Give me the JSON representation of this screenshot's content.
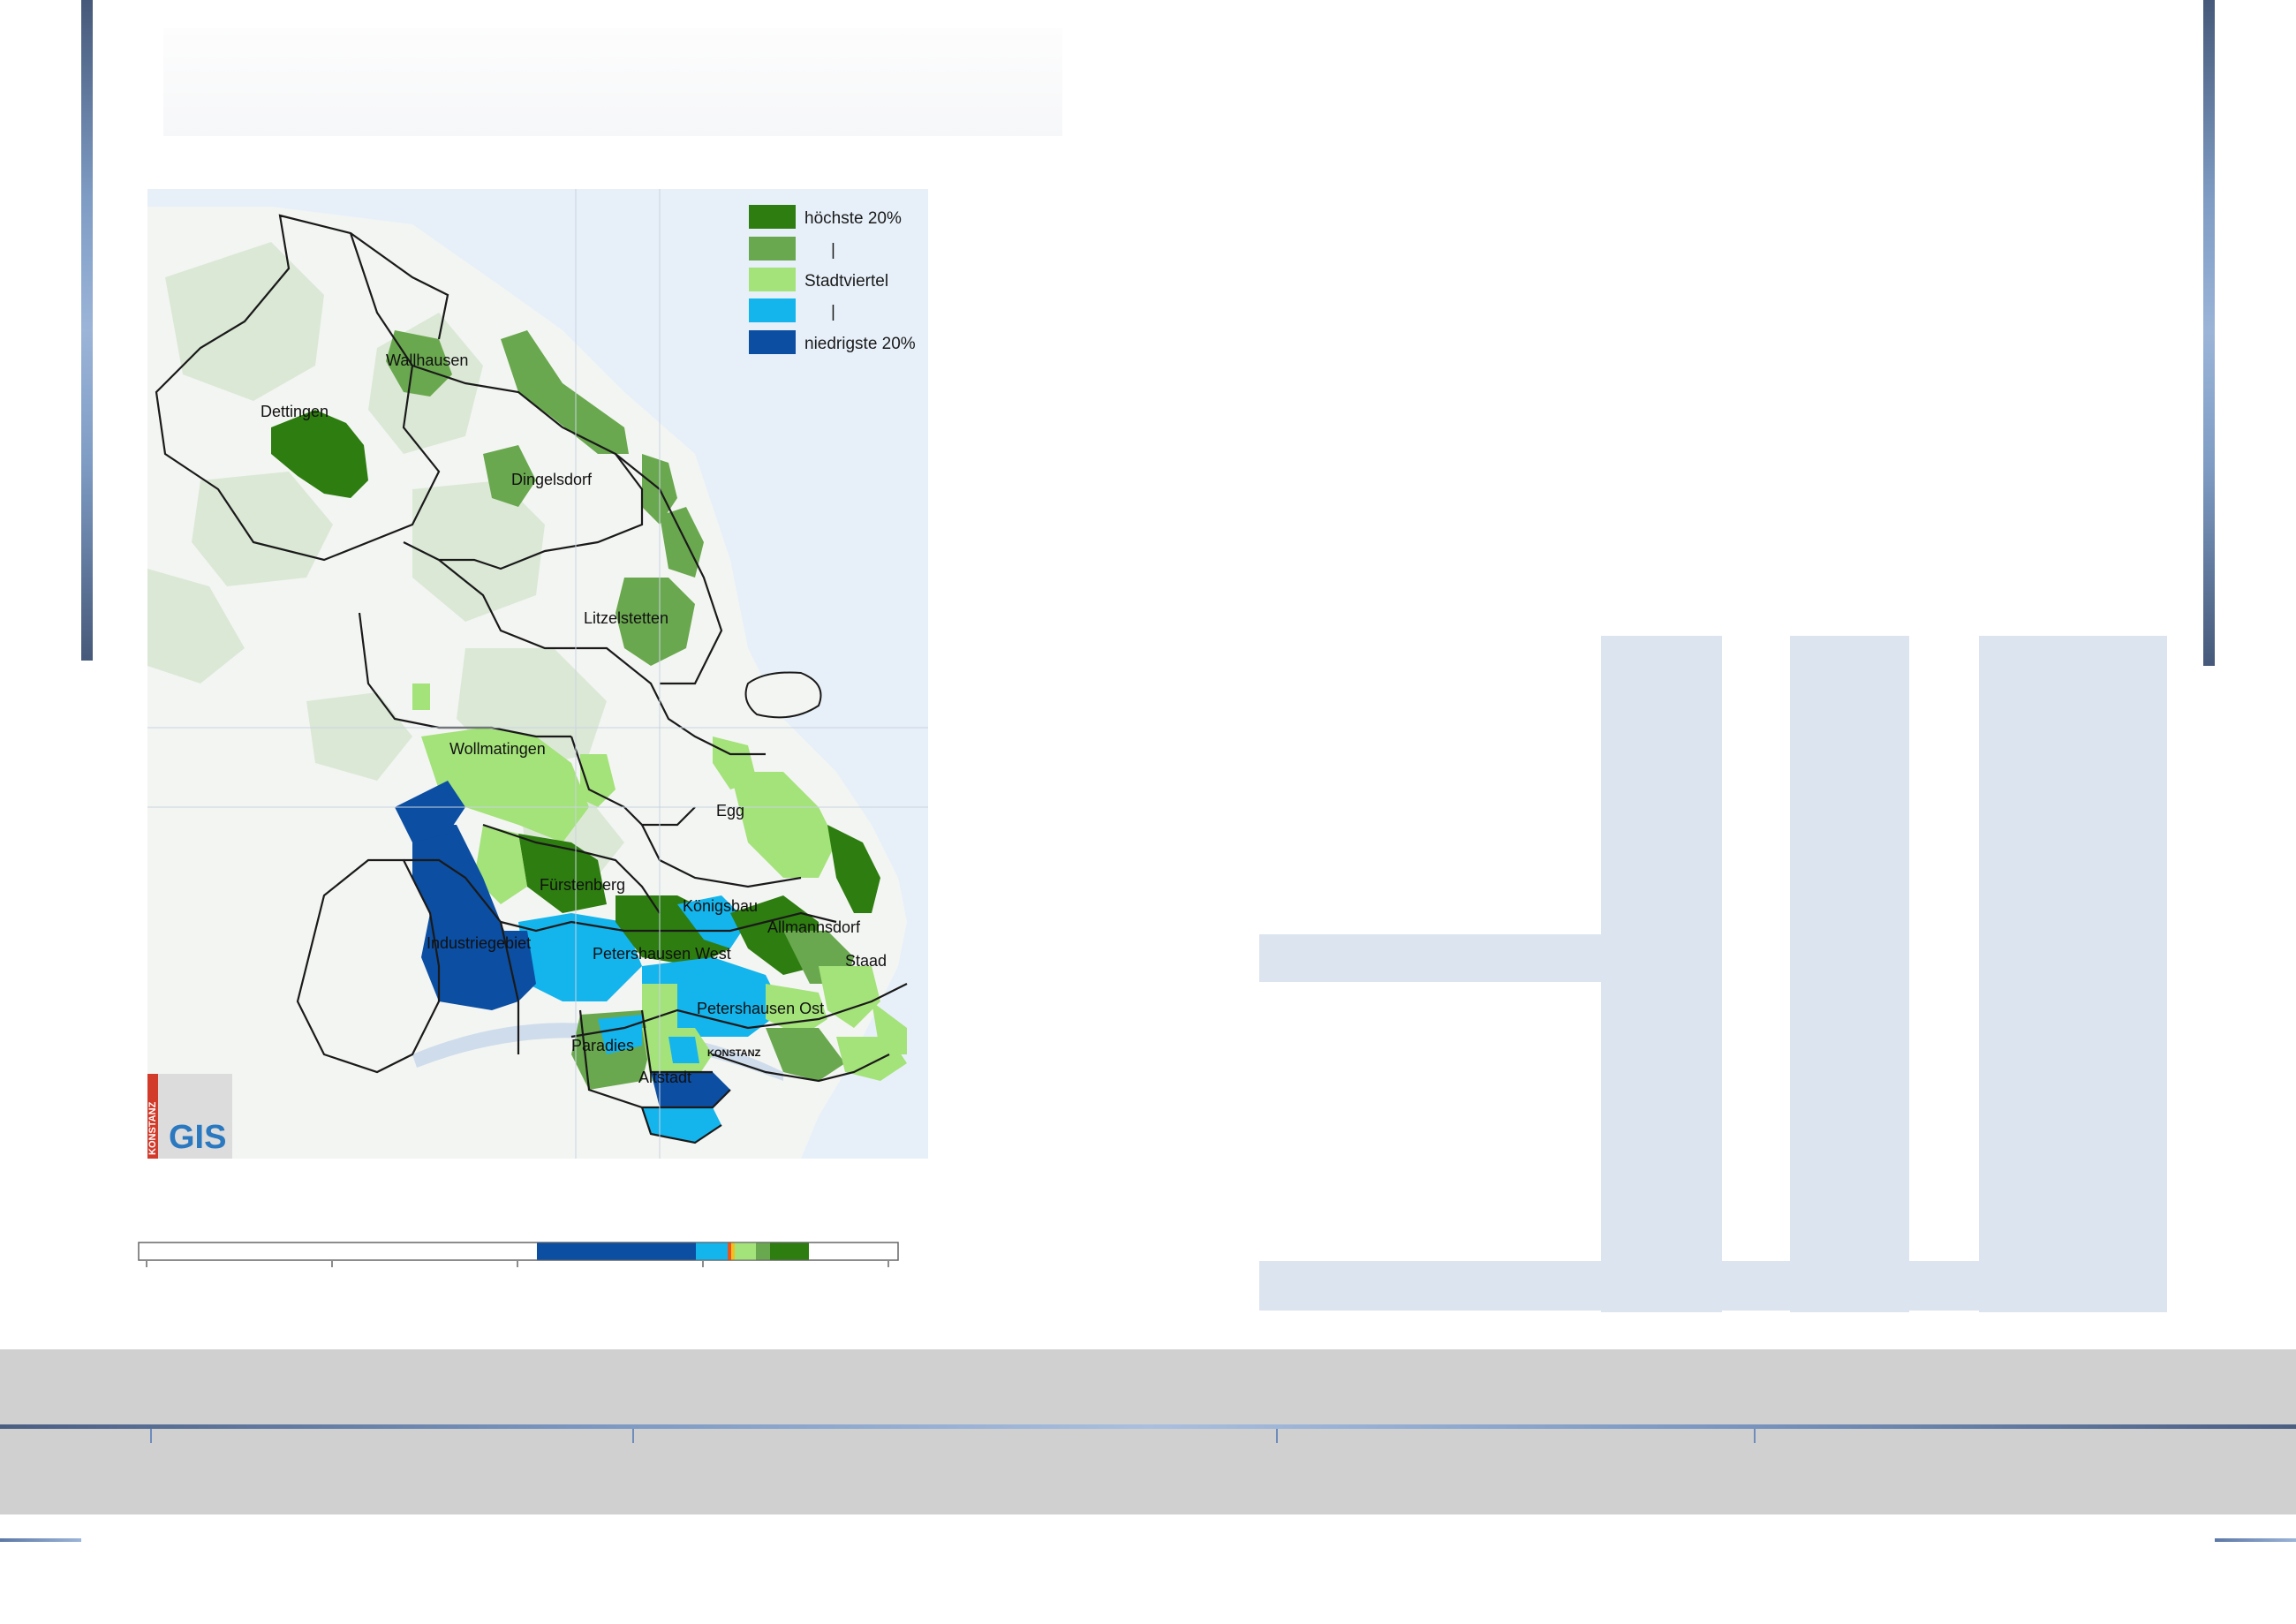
{
  "map": {
    "legend": {
      "items": [
        {
          "label": "höchste 20%",
          "color": "#2e7d10"
        },
        {
          "label": "|",
          "color": "#6aa84f"
        },
        {
          "label": "Stadtviertel",
          "color": "#a4e27a"
        },
        {
          "label": "|",
          "color": "#14b4ec"
        },
        {
          "label": "niedrigste 20%",
          "color": "#0b4ea2"
        }
      ]
    },
    "districts": {
      "wallhausen": "Wallhausen",
      "dettingen": "Dettingen",
      "dingelsdorf": "Dingelsdorf",
      "litzelstetten": "Litzelstetten",
      "wollmatingen": "Wollmatingen",
      "egg": "Egg",
      "fuerstenberg": "Fürstenberg",
      "koenigsbau": "Königsbau",
      "allmannsdorf": "Allmannsdorf",
      "industriegebiet": "Industriegebiet",
      "petershausen_west": "Petershausen West",
      "staad": "Staad",
      "petershausen_ost": "Petershausen Ost",
      "paradies": "Paradies",
      "altstadt": "Altstadt"
    },
    "city_label": "KONSTANZ",
    "logo": {
      "text": "GIS",
      "side_text": "KONSTANZ"
    }
  },
  "colors": {
    "highest": "#2e7d10",
    "high": "#6aa84f",
    "mid": "#a4e27a",
    "low": "#14b4ec",
    "lowest": "#0b4ea2",
    "band_grey": "#d0d0d0",
    "table_fill": "#dce4f0"
  }
}
